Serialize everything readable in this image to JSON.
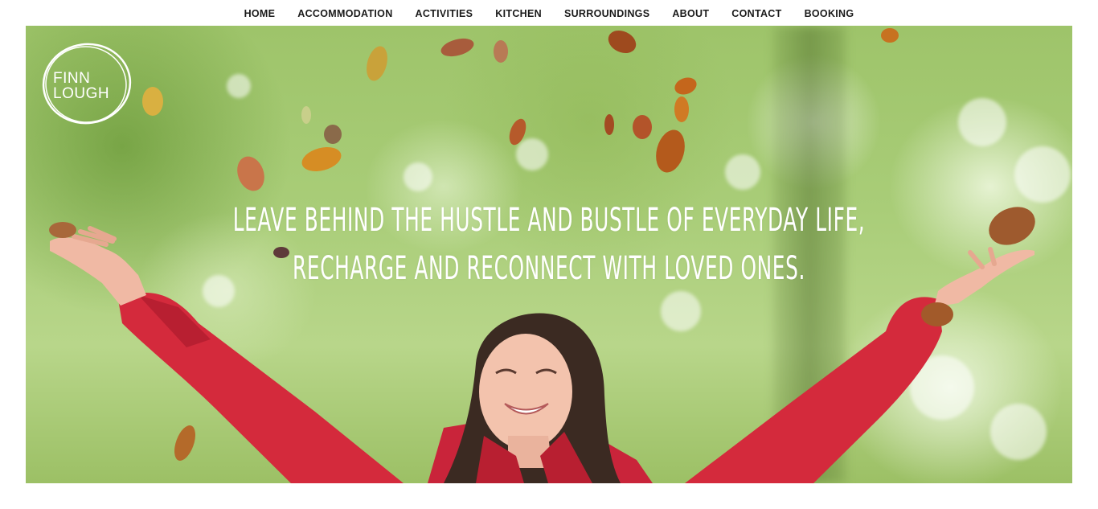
{
  "nav": {
    "items": [
      {
        "label": "HOME"
      },
      {
        "label": "ACCOMMODATION"
      },
      {
        "label": "ACTIVITIES"
      },
      {
        "label": "KITCHEN"
      },
      {
        "label": "SURROUNDINGS"
      },
      {
        "label": "ABOUT"
      },
      {
        "label": "CONTACT"
      },
      {
        "label": "BOOKING"
      }
    ]
  },
  "logo": {
    "line1": "FINN",
    "line2": "LOUGH"
  },
  "hero": {
    "tagline_line1": "LEAVE BEHIND THE HUSTLE AND BUSTLE OF EVERYDAY LIFE,",
    "tagline_line2": "RECHARGE AND RECONNECT WITH LOVED ONES."
  },
  "colors": {
    "nav_text": "#1a1a1a",
    "tagline_text": "#ffffff",
    "jacket_red": "#d42a3c",
    "foliage_green": "#9ec46a"
  }
}
